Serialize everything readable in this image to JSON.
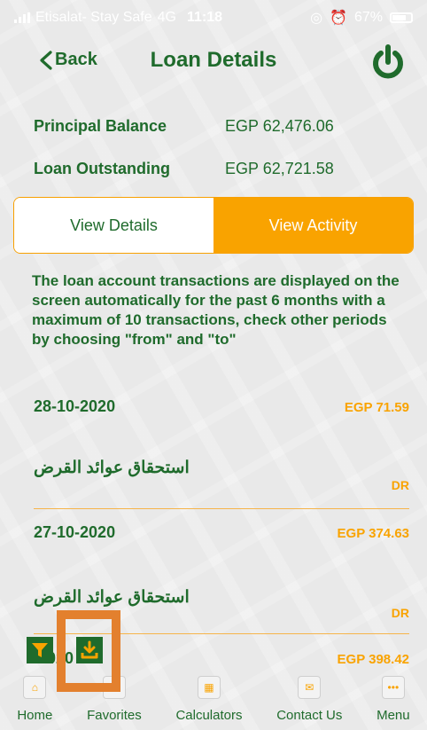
{
  "status_bar": {
    "carrier": "Etisalat- Stay Safe",
    "network": "4G",
    "time": "11:18",
    "battery": "67%"
  },
  "nav": {
    "back_label": "Back",
    "title": "Loan Details"
  },
  "summary": {
    "principal_label": "Principal Balance",
    "principal_value": "EGP 62,476.06",
    "outstanding_label": "Loan Outstanding",
    "outstanding_value": "EGP 62,721.58"
  },
  "toggle": {
    "details_label": "View Details",
    "activity_label": "View Activity"
  },
  "note": "The loan account transactions are displayed on the screen automatically for the past 6 months with a maximum of 10 transactions, check other periods by choosing \"from\" and \"to\"",
  "transactions": [
    {
      "date": "28-10-2020",
      "amount": "EGP 71.59",
      "description": "استحقاق عوائد القرض",
      "type": "DR"
    },
    {
      "date": "27-10-2020",
      "amount": "EGP 374.63",
      "description": "استحقاق عوائد القرض",
      "type": "DR"
    },
    {
      "date": "1  020",
      "amount": "EGP 398.42"
    }
  ],
  "tabs": [
    {
      "label": "Home",
      "icon": "home-icon"
    },
    {
      "label": "Favorites",
      "icon": "star-icon"
    },
    {
      "label": "Calculators",
      "icon": "calculator-icon"
    },
    {
      "label": "Contact Us",
      "icon": "envelope-icon"
    },
    {
      "label": "Menu",
      "icon": "more-icon"
    }
  ],
  "colors": {
    "brand_green": "#1f6b2c",
    "accent_orange": "#f9a300",
    "highlight_orange": "#e3802e"
  }
}
